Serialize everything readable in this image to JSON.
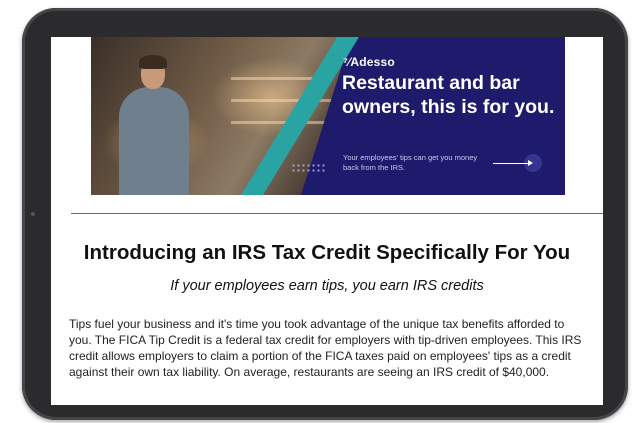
{
  "banner": {
    "brand": "Adesso",
    "headline": "Restaurant and bar owners, this is for you.",
    "tagline": "Your employees' tips can get you money back from the IRS.",
    "colors": {
      "navy": "#1e1b6c",
      "teal": "#2aa3a3"
    }
  },
  "article": {
    "title": "Introducing an IRS Tax Credit Specifically For You",
    "subtitle": "If your employees earn tips, you earn IRS credits",
    "body": "Tips fuel your business and it's time you took advantage of the unique tax benefits afforded to you. The FICA Tip Credit is a federal tax credit for employers with tip-driven employees. This IRS credit allows employers to claim a portion of the FICA taxes paid on employees' tips as a credit against their own tax liability. On average, restaurants are seeing an IRS credit of $40,000."
  },
  "icons": {
    "arrow": "arrow-right-icon"
  }
}
